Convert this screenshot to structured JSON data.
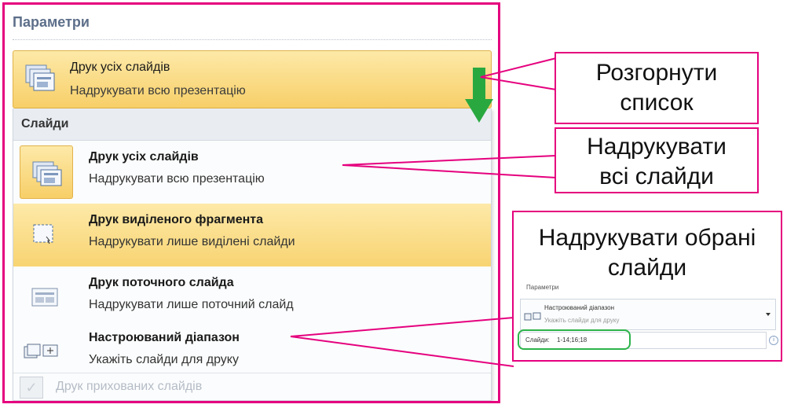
{
  "section_title": "Параметри",
  "dropdown": {
    "main": "Друк усіх слайдів",
    "sub": "Надрукувати всю презентацію"
  },
  "list": {
    "header": "Слайди",
    "items": [
      {
        "title": "Друк усіх слайдів",
        "desc": "Надрукувати всю презентацію"
      },
      {
        "title": "Друк виділеного фрагмента",
        "desc": "Надрукувати лише виділені слайди"
      },
      {
        "title": "Друк поточного слайда",
        "desc": "Надрукувати лише поточний слайд"
      },
      {
        "title": "Настроюваний діапазон",
        "desc": "Укажіть слайди для друку"
      }
    ],
    "hidden_option": "Друк прихованих слайдів"
  },
  "callouts": {
    "expand_line1": "Розгорнути",
    "expand_line2": "список",
    "print_all_line1": "Надрукувати",
    "print_all_line2": "всі слайди",
    "print_selected_line1": "Надрукувати обрані",
    "print_selected_line2": "слайди"
  },
  "mini": {
    "title": "Параметри",
    "dropdown_main": "Настроюваний діапазон",
    "dropdown_sub": "Укажіть слайди для друку",
    "field_label": "Слайди:",
    "field_value": "1-14;16;18"
  },
  "colors": {
    "accent_frame": "#e5007e",
    "highlight": "#f8d472",
    "arrow_green": "#2aa840"
  }
}
